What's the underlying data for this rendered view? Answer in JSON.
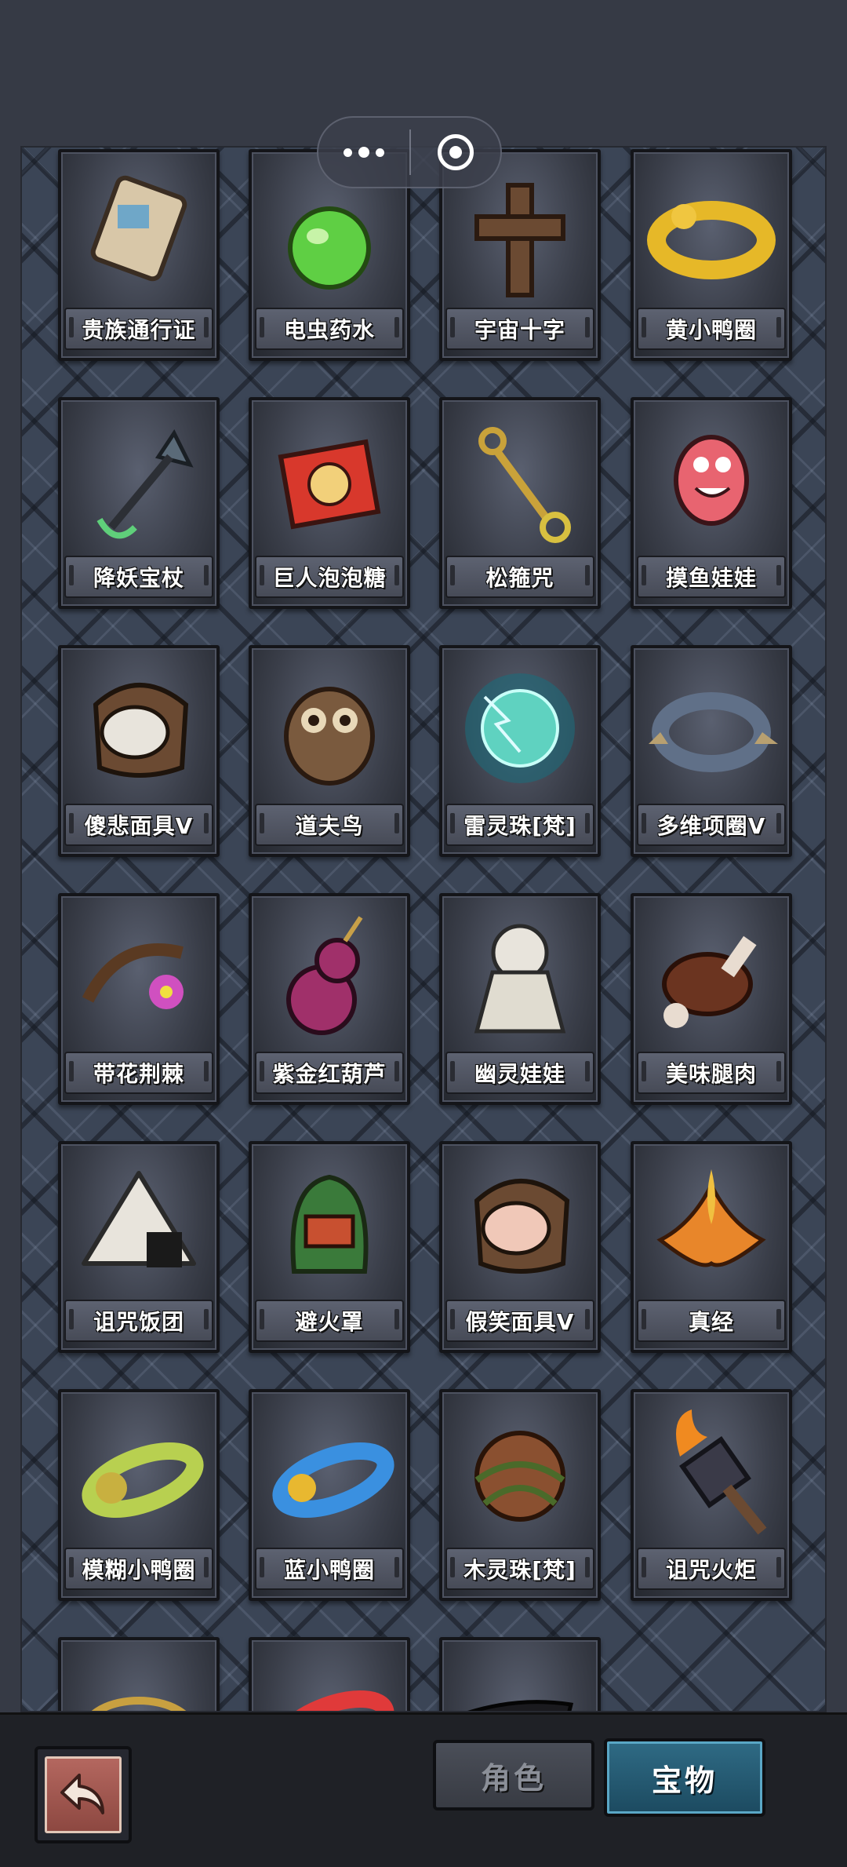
{
  "top_bar": {
    "menu_button_icon": "more-dots-icon",
    "close_button_icon": "record-target-icon"
  },
  "items": [
    {
      "name": "贵族通行证",
      "icon": "noble-pass-icon"
    },
    {
      "name": "电虫药水",
      "icon": "potion-icon"
    },
    {
      "name": "宇宙十字",
      "icon": "cosmic-cross-icon"
    },
    {
      "name": "黄小鸭圈",
      "icon": "yellow-duck-ring-icon"
    },
    {
      "name": "降妖宝杖",
      "icon": "demon-staff-icon"
    },
    {
      "name": "巨人泡泡糖",
      "icon": "bubble-gum-box-icon"
    },
    {
      "name": "松箍咒",
      "icon": "golden-key-icon"
    },
    {
      "name": "摸鱼娃娃",
      "icon": "pink-doll-icon"
    },
    {
      "name": "傻悲面具V",
      "icon": "sad-mask-icon"
    },
    {
      "name": "道夫鸟",
      "icon": "owl-icon"
    },
    {
      "name": "雷灵珠[梵]",
      "icon": "thunder-orb-icon"
    },
    {
      "name": "多维项圈V",
      "icon": "spiked-collar-icon"
    },
    {
      "name": "带花荆棘",
      "icon": "flower-thorn-icon"
    },
    {
      "name": "紫金红葫芦",
      "icon": "gourd-icon"
    },
    {
      "name": "幽灵娃娃",
      "icon": "ghost-doll-icon"
    },
    {
      "name": "美味腿肉",
      "icon": "meat-leg-icon"
    },
    {
      "name": "诅咒饭团",
      "icon": "rice-ball-icon"
    },
    {
      "name": "避火罩",
      "icon": "fire-hood-icon"
    },
    {
      "name": "假笑面具V",
      "icon": "smile-mask-icon"
    },
    {
      "name": "真经",
      "icon": "fire-lotus-icon"
    },
    {
      "name": "模糊小鸭圈",
      "icon": "blurry-duck-ring-icon"
    },
    {
      "name": "蓝小鸭圈",
      "icon": "blue-duck-ring-icon"
    },
    {
      "name": "木灵珠[梵]",
      "icon": "wood-orb-icon"
    },
    {
      "name": "诅咒火炬",
      "icon": "cursed-torch-icon"
    },
    {
      "name": "",
      "icon": "gold-bracelet-icon"
    },
    {
      "name": "",
      "icon": "red-duck-ring-icon"
    },
    {
      "name": "",
      "icon": "sunglasses-icon"
    }
  ],
  "bottom_bar": {
    "back_icon": "back-arrow-icon",
    "tab_role": "角色",
    "tab_treasure": "宝物",
    "active_tab": "宝物"
  }
}
